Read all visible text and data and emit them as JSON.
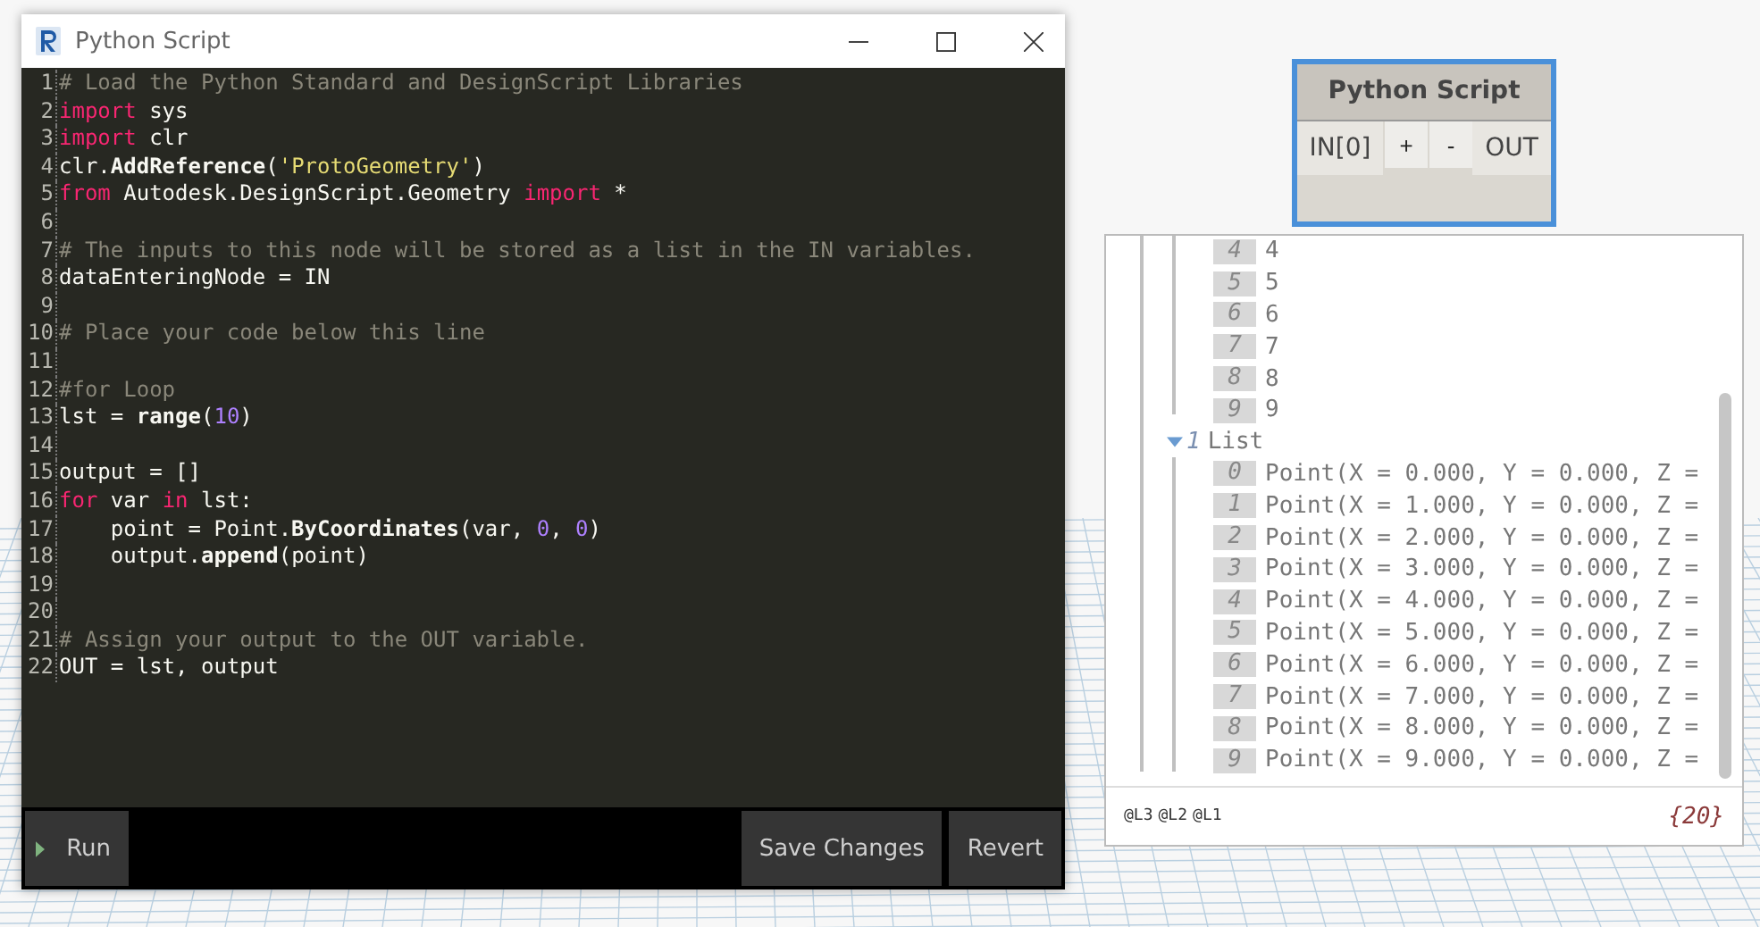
{
  "window": {
    "title": "Python Script"
  },
  "editor": {
    "lines": [
      {
        "number": "1",
        "tokens": [
          {
            "kind": "comment",
            "text": "# Load the Python Standard and DesignScript Libraries"
          }
        ]
      },
      {
        "number": "2",
        "tokens": [
          {
            "kind": "keyword",
            "text": "import"
          },
          {
            "kind": "plain",
            "text": " sys"
          }
        ]
      },
      {
        "number": "3",
        "tokens": [
          {
            "kind": "keyword",
            "text": "import"
          },
          {
            "kind": "plain",
            "text": " clr"
          }
        ]
      },
      {
        "number": "4",
        "tokens": [
          {
            "kind": "plain",
            "text": "clr."
          },
          {
            "kind": "func",
            "text": "AddReference"
          },
          {
            "kind": "plain",
            "text": "("
          },
          {
            "kind": "string",
            "text": "'ProtoGeometry'"
          },
          {
            "kind": "plain",
            "text": ")"
          }
        ]
      },
      {
        "number": "5",
        "tokens": [
          {
            "kind": "keyword",
            "text": "from"
          },
          {
            "kind": "plain",
            "text": " Autodesk.DesignScript.Geometry "
          },
          {
            "kind": "keyword",
            "text": "import"
          },
          {
            "kind": "plain",
            "text": " *"
          }
        ]
      },
      {
        "number": "6"
      },
      {
        "number": "7",
        "tokens": [
          {
            "kind": "comment",
            "text": "# The inputs to this node will be stored as a list in the IN variables."
          }
        ]
      },
      {
        "number": "8",
        "tokens": [
          {
            "kind": "plain",
            "text": "dataEnteringNode = IN"
          }
        ]
      },
      {
        "number": "9"
      },
      {
        "number": "10",
        "tokens": [
          {
            "kind": "comment",
            "text": "# Place your code below this line"
          }
        ]
      },
      {
        "number": "11"
      },
      {
        "number": "12",
        "tokens": [
          {
            "kind": "comment",
            "text": "#for Loop"
          }
        ]
      },
      {
        "number": "13",
        "tokens": [
          {
            "kind": "plain",
            "text": "lst = "
          },
          {
            "kind": "func",
            "text": "range"
          },
          {
            "kind": "plain",
            "text": "("
          },
          {
            "kind": "number",
            "text": "10"
          },
          {
            "kind": "plain",
            "text": ")"
          }
        ]
      },
      {
        "number": "14"
      },
      {
        "number": "15",
        "tokens": [
          {
            "kind": "plain",
            "text": "output = []"
          }
        ]
      },
      {
        "number": "16",
        "tokens": [
          {
            "kind": "keyword",
            "text": "for"
          },
          {
            "kind": "plain",
            "text": " var "
          },
          {
            "kind": "keyword",
            "text": "in"
          },
          {
            "kind": "plain",
            "text": " lst:"
          }
        ]
      },
      {
        "number": "17",
        "tokens": [
          {
            "kind": "plain",
            "text": "    point = Point."
          },
          {
            "kind": "func",
            "text": "ByCoordinates"
          },
          {
            "kind": "plain",
            "text": "(var, "
          },
          {
            "kind": "number",
            "text": "0"
          },
          {
            "kind": "plain",
            "text": ", "
          },
          {
            "kind": "number",
            "text": "0"
          },
          {
            "kind": "plain",
            "text": ")"
          }
        ]
      },
      {
        "number": "18",
        "tokens": [
          {
            "kind": "plain",
            "text": "    output."
          },
          {
            "kind": "func",
            "text": "append"
          },
          {
            "kind": "plain",
            "text": "(point)"
          }
        ]
      },
      {
        "number": "19"
      },
      {
        "number": "20"
      },
      {
        "number": "21",
        "tokens": [
          {
            "kind": "comment",
            "text": "# Assign your output to the OUT variable."
          }
        ]
      },
      {
        "number": "22",
        "tokens": [
          {
            "kind": "plain",
            "text": "OUT = lst, output"
          }
        ]
      }
    ]
  },
  "actions": {
    "run": "Run",
    "save": "Save Changes",
    "revert": "Revert"
  },
  "node": {
    "title": "Python Script",
    "input": "IN[0]",
    "add": "+",
    "remove": "-",
    "output": "OUT"
  },
  "preview": {
    "items": [
      {
        "index": "4",
        "value": "4"
      },
      {
        "index": "5",
        "value": "5"
      },
      {
        "index": "6",
        "value": "6"
      },
      {
        "index": "7",
        "value": "7"
      },
      {
        "index": "8",
        "value": "8"
      },
      {
        "index": "9",
        "value": "9"
      }
    ],
    "list": {
      "index": "1",
      "label": "List",
      "expanded": true,
      "items": [
        {
          "index": "0",
          "value": "Point(X = 0.000, Y = 0.000, Z ="
        },
        {
          "index": "1",
          "value": "Point(X = 1.000, Y = 0.000, Z ="
        },
        {
          "index": "2",
          "value": "Point(X = 2.000, Y = 0.000, Z ="
        },
        {
          "index": "3",
          "value": "Point(X = 3.000, Y = 0.000, Z ="
        },
        {
          "index": "4",
          "value": "Point(X = 4.000, Y = 0.000, Z ="
        },
        {
          "index": "5",
          "value": "Point(X = 5.000, Y = 0.000, Z ="
        },
        {
          "index": "6",
          "value": "Point(X = 6.000, Y = 0.000, Z ="
        },
        {
          "index": "7",
          "value": "Point(X = 7.000, Y = 0.000, Z ="
        },
        {
          "index": "8",
          "value": "Point(X = 8.000, Y = 0.000, Z ="
        },
        {
          "index": "9",
          "value": "Point(X = 9.000, Y = 0.000, Z ="
        }
      ]
    },
    "levels": [
      "@L3",
      "@L2",
      "@L1"
    ],
    "count": "{20}"
  }
}
